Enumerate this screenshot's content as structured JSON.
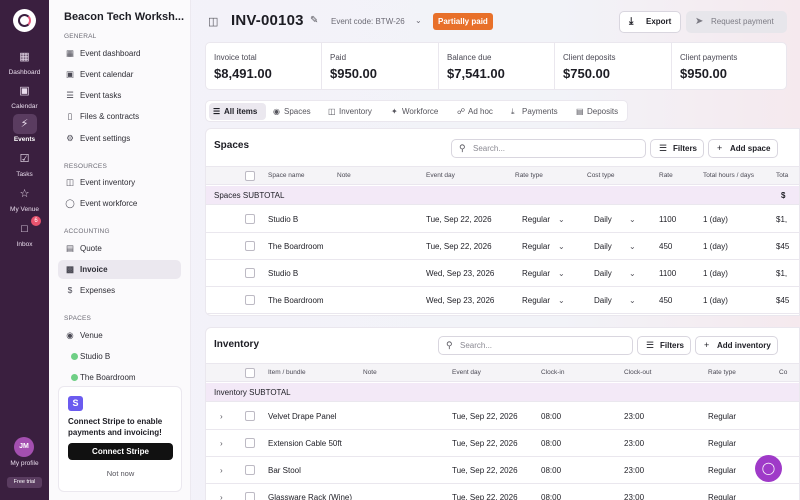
{
  "rail": {
    "items": [
      {
        "label": "Dashboard",
        "icon": "grid-icon"
      },
      {
        "label": "Calendar",
        "icon": "calendar-icon"
      },
      {
        "label": "Events",
        "icon": "lightning-icon"
      },
      {
        "label": "Tasks",
        "icon": "clipboard-icon"
      },
      {
        "label": "My Venue",
        "icon": "star-icon"
      },
      {
        "label": "Inbox",
        "icon": "chat-icon",
        "badge": "6"
      }
    ],
    "avatar_initials": "JM",
    "profile_label": "My profile",
    "free_trial_label": "Free trial"
  },
  "sidebar": {
    "workspace_title": "Beacon Tech Worksh...",
    "general_heading": "GENERAL",
    "general": [
      "Event dashboard",
      "Event calendar",
      "Event tasks",
      "Files & contracts",
      "Event settings"
    ],
    "resources_heading": "RESOURCES",
    "resources": [
      "Event inventory",
      "Event workforce"
    ],
    "accounting_heading": "ACCOUNTING",
    "accounting": [
      "Quote",
      "Invoice",
      "Expenses"
    ],
    "spaces_heading": "SPACES",
    "spaces": [
      "Venue",
      "Studio B",
      "The Boardroom"
    ]
  },
  "stripe": {
    "logo_letter": "S",
    "text": "Connect Stripe to enable payments and invoicing!",
    "button": "Connect Stripe",
    "later": "Not now"
  },
  "header": {
    "invoice_number": "INV-00103",
    "event_code": "Event code: BTW-26",
    "status": "Partially paid",
    "export_label": "Export",
    "request_payment_label": "Request payment"
  },
  "summary": [
    {
      "label": "Invoice total",
      "value": "$8,491.00"
    },
    {
      "label": "Paid",
      "value": "$950.00"
    },
    {
      "label": "Balance due",
      "value": "$7,541.00"
    },
    {
      "label": "Client deposits",
      "value": "$750.00"
    },
    {
      "label": "Client payments",
      "value": "$950.00"
    }
  ],
  "tabs": [
    "All items",
    "Spaces",
    "Inventory",
    "Workforce",
    "Ad hoc",
    "Payments",
    "Deposits"
  ],
  "spaces": {
    "title": "Spaces",
    "search_placeholder": "Search...",
    "filters_label": "Filters",
    "add_label": "Add space",
    "columns": [
      "Space name",
      "Note",
      "Event day",
      "Rate type",
      "Cost type",
      "Rate",
      "Total hours / days",
      "Tota"
    ],
    "subtotal_label": "Spaces SUBTOTAL",
    "subtotal_value": "$",
    "rows": [
      {
        "name": "Studio B",
        "note": "",
        "day": "Tue, Sep 22, 2026",
        "rate_type": "Regular",
        "cost_type": "Daily",
        "rate": "1100",
        "total_hours": "1 (day)",
        "total": "$1,"
      },
      {
        "name": "The Boardroom",
        "note": "",
        "day": "Tue, Sep 22, 2026",
        "rate_type": "Regular",
        "cost_type": "Daily",
        "rate": "450",
        "total_hours": "1 (day)",
        "total": "$45"
      },
      {
        "name": "Studio B",
        "note": "",
        "day": "Wed, Sep 23, 2026",
        "rate_type": "Regular",
        "cost_type": "Daily",
        "rate": "1100",
        "total_hours": "1 (day)",
        "total": "$1,"
      },
      {
        "name": "The Boardroom",
        "note": "",
        "day": "Wed, Sep 23, 2026",
        "rate_type": "Regular",
        "cost_type": "Daily",
        "rate": "450",
        "total_hours": "1 (day)",
        "total": "$45"
      }
    ]
  },
  "inventory": {
    "title": "Inventory",
    "search_placeholder": "Search...",
    "filters_label": "Filters",
    "add_label": "Add inventory",
    "columns": [
      "Item / bundle",
      "Note",
      "Event day",
      "Clock-in",
      "Clock-out",
      "Rate type",
      "Co"
    ],
    "subtotal_label": "Inventory SUBTOTAL",
    "rows": [
      {
        "name": "Velvet Drape Panel",
        "day": "Tue, Sep 22, 2026",
        "clock_in": "08:00",
        "clock_out": "23:00",
        "rate_type": "Regular"
      },
      {
        "name": "Extension Cable 50ft",
        "day": "Tue, Sep 22, 2026",
        "clock_in": "08:00",
        "clock_out": "23:00",
        "rate_type": "Regular"
      },
      {
        "name": "Bar Stool",
        "day": "Tue, Sep 22, 2026",
        "clock_in": "08:00",
        "clock_out": "23:00",
        "rate_type": "Regular"
      },
      {
        "name": "Glassware Rack (Wine)",
        "day": "Tue, Sep 22, 2026",
        "clock_in": "08:00",
        "clock_out": "23:00",
        "rate_type": "Regular"
      }
    ]
  }
}
